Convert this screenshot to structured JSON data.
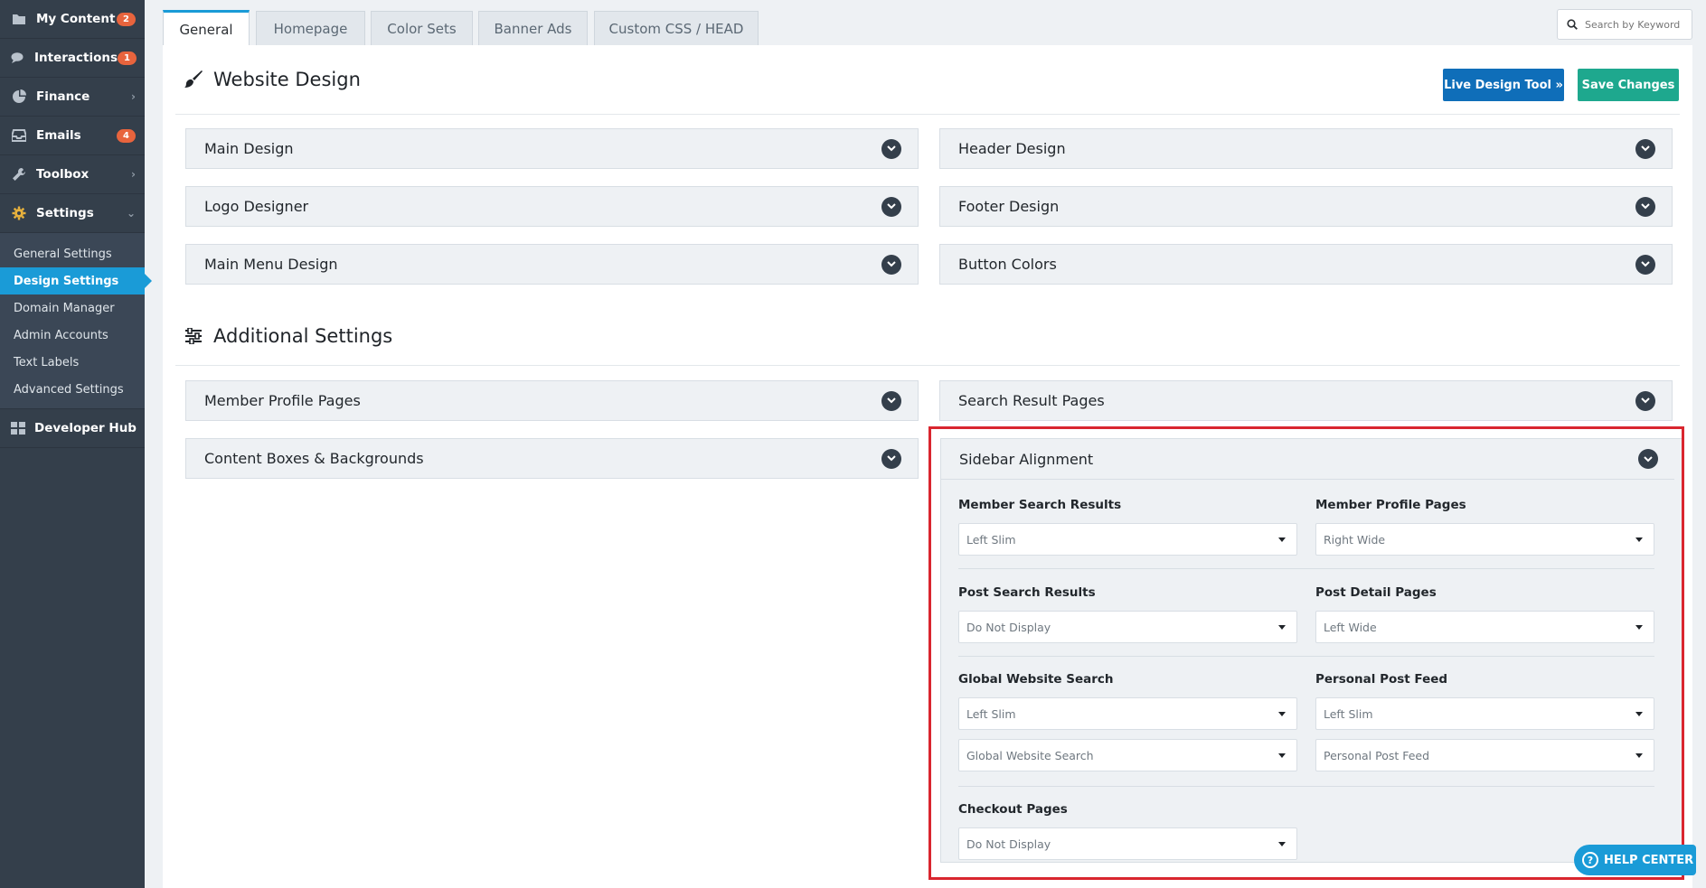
{
  "sidebar": {
    "items": [
      {
        "label": "My Content",
        "icon": "folder-icon",
        "badge": "2"
      },
      {
        "label": "Interactions",
        "icon": "comments-icon",
        "badge": "1"
      },
      {
        "label": "Finance",
        "icon": "pie-chart-icon",
        "chevron": "›"
      },
      {
        "label": "Emails",
        "icon": "inbox-icon",
        "badge": "4"
      },
      {
        "label": "Toolbox",
        "icon": "wrench-icon",
        "chevron": "›"
      },
      {
        "label": "Settings",
        "icon": "gear-icon",
        "chevron": "⌄"
      }
    ],
    "settings_sub": [
      "General Settings",
      "Design Settings",
      "Domain Manager",
      "Admin Accounts",
      "Text Labels",
      "Advanced Settings"
    ],
    "developer_hub": {
      "label": "Developer Hub",
      "icon": "grid-icon"
    }
  },
  "tabs": [
    "General",
    "Homepage",
    "Color Sets",
    "Banner Ads",
    "Custom CSS / HEAD"
  ],
  "search": {
    "placeholder": "Search by Keyword"
  },
  "website_design": {
    "title": "Website Design",
    "live_design_label": "Live Design Tool »",
    "save_label": "Save Changes",
    "panels": [
      "Main Design",
      "Header Design",
      "Logo Designer",
      "Footer Design",
      "Main Menu Design",
      "Button Colors"
    ]
  },
  "additional": {
    "title": "Additional Settings",
    "panels": [
      "Member Profile Pages",
      "Search Result Pages",
      "Content Boxes & Backgrounds"
    ],
    "sidebar_alignment": {
      "title": "Sidebar Alignment",
      "fields": [
        {
          "label": "Member Search Results",
          "value": "Left Slim"
        },
        {
          "label": "Member Profile Pages",
          "value": "Right Wide"
        },
        {
          "label": "Post Search Results",
          "value": "Do Not Display"
        },
        {
          "label": "Post Detail Pages",
          "value": "Left Wide"
        },
        {
          "label": "Global Website Search",
          "value": "Left Slim",
          "second_value": "Global Website Search"
        },
        {
          "label": "Personal Post Feed",
          "value": "Left Slim",
          "second_value": "Personal Post Feed"
        },
        {
          "label": "Checkout Pages",
          "value": "Do Not Display"
        }
      ]
    }
  },
  "help_center": {
    "label": "HELP CENTER"
  },
  "colors": {
    "sidebar": "#343f4b",
    "accent": "#1a9bd7",
    "primary_button": "#0f6eb9",
    "save_button": "#1ea88e",
    "highlight": "#d9262f"
  }
}
